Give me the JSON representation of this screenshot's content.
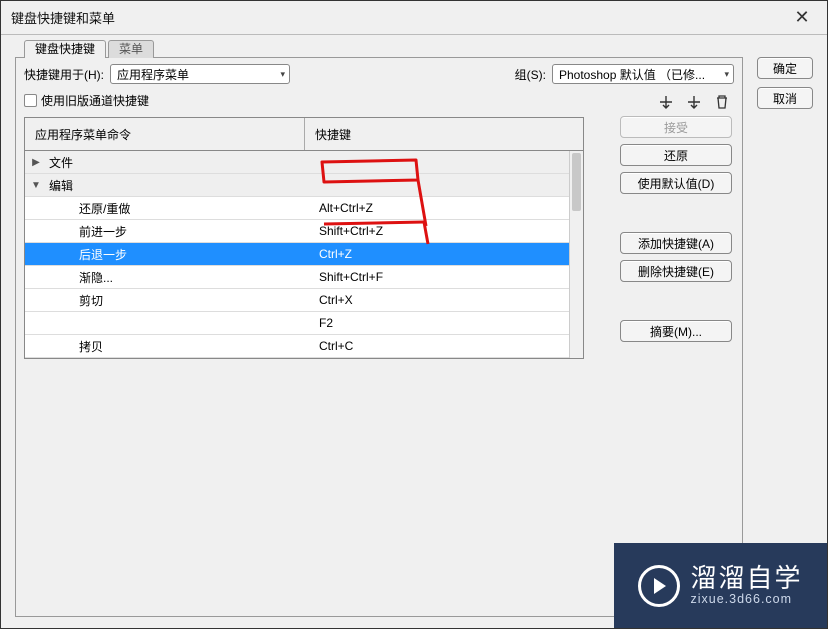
{
  "window": {
    "title": "键盘快捷键和菜单"
  },
  "outer_buttons": {
    "ok": "确定",
    "cancel": "取消"
  },
  "tabs": {
    "shortcuts": "键盘快捷键",
    "menus": "菜单"
  },
  "toprow": {
    "shortcuts_for_label": "快捷键用于(H):",
    "shortcuts_for_value": "应用程序菜单",
    "set_label": "组(S):",
    "set_value": "Photoshop 默认值 （已修..."
  },
  "legacy_checkbox": "使用旧版通道快捷键",
  "columns": {
    "command": "应用程序菜单命令",
    "shortcut": "快捷键"
  },
  "rows": [
    {
      "type": "group",
      "expanded": false,
      "label": "文件",
      "shortcut": ""
    },
    {
      "type": "group",
      "expanded": true,
      "label": "编辑",
      "shortcut": ""
    },
    {
      "type": "item",
      "label": "还原/重做",
      "shortcut": "Alt+Ctrl+Z",
      "selected": false
    },
    {
      "type": "item",
      "label": "前进一步",
      "shortcut": "Shift+Ctrl+Z",
      "selected": false
    },
    {
      "type": "item",
      "label": "后退一步",
      "shortcut": "Ctrl+Z",
      "selected": true
    },
    {
      "type": "item",
      "label": "渐隐...",
      "shortcut": "Shift+Ctrl+F",
      "selected": false
    },
    {
      "type": "item",
      "label": "剪切",
      "shortcut": "Ctrl+X",
      "selected": false
    },
    {
      "type": "item",
      "label": "",
      "shortcut": "F2",
      "selected": false
    },
    {
      "type": "item",
      "label": "拷贝",
      "shortcut": "Ctrl+C",
      "selected": false
    }
  ],
  "side_buttons": {
    "accept": "接受",
    "undo": "还原",
    "use_default": "使用默认值(D)",
    "add": "添加快捷键(A)",
    "delete": "删除快捷键(E)",
    "summary": "摘要(M)..."
  },
  "watermark": {
    "top": "溜溜自学",
    "bottom": "zixue.3d66.com"
  }
}
